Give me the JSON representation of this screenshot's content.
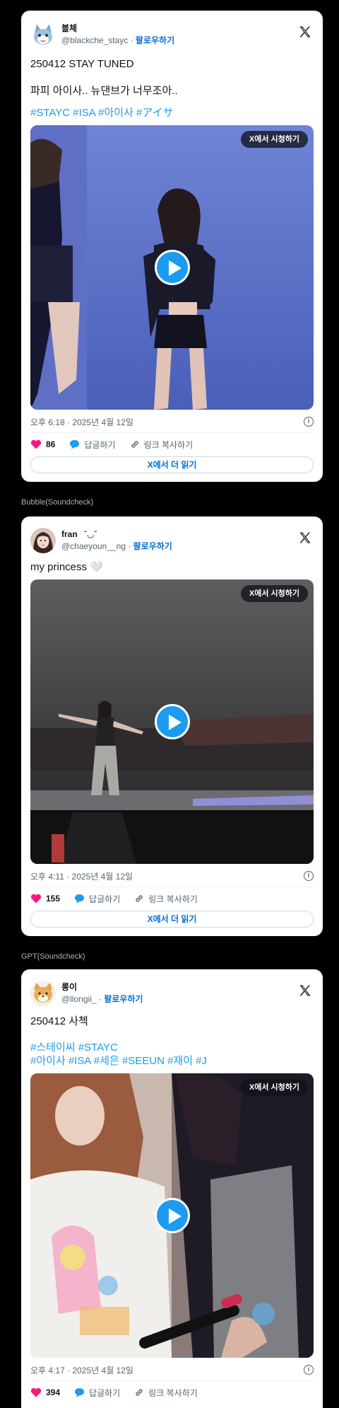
{
  "posts": [
    {
      "display_name": "블체",
      "handle": "@blackche_stayc",
      "follow": "팔로우하기",
      "text": "250412 STAY TUNED\n\n파피 아이사.. 뉴댄브가 너무조아..",
      "hashtags": "#STAYC #ISA #아이사  #アイサ",
      "watch_label": "X에서 시청하기",
      "timestamp": "오후 6:18 · 2025년 4월 12일",
      "likes": "86",
      "reply": "답글하기",
      "copy_link": "링크 복사하기",
      "read_more": "X에서 더 읽기"
    },
    {
      "display_name": "fran",
      "name_emoji": "˘◡˘",
      "handle": "@chaeyoun__ng",
      "follow": "팔로우하기",
      "text": "my princess 🤍",
      "watch_label": "X에서 시청하기",
      "timestamp": "오후 4:11 · 2025년 4월 12일",
      "likes": "155",
      "reply": "답글하기",
      "copy_link": "링크 복사하기",
      "read_more": "X에서 더 읽기"
    },
    {
      "display_name": "롱이",
      "handle": "@llongii_",
      "follow": "팔로우하기",
      "text": "250412 사첵",
      "hashtags_1": "#스테이씨 #STAYC",
      "hashtags_2": "#아이사 #ISA #세은 #SEEUN #재이 #J",
      "watch_label": "X에서 시청하기",
      "timestamp": "오후 4:17 · 2025년 4월 12일",
      "likes": "394",
      "reply": "답글하기",
      "copy_link": "링크 복사하기"
    }
  ],
  "captions": {
    "bubble": "Bubble(Soundcheck)",
    "gpt": "GPT(Soundcheck)"
  },
  "icons": {
    "x_logo": "x-logo-icon",
    "play": "play-icon",
    "heart": "heart-icon",
    "reply": "reply-bubble-icon",
    "link": "link-icon",
    "info": "info-icon"
  },
  "colors": {
    "background": "#000000",
    "link_blue": "#006fd6",
    "hashtag_blue": "#1d9bf0",
    "heart_pink": "#f91880"
  }
}
